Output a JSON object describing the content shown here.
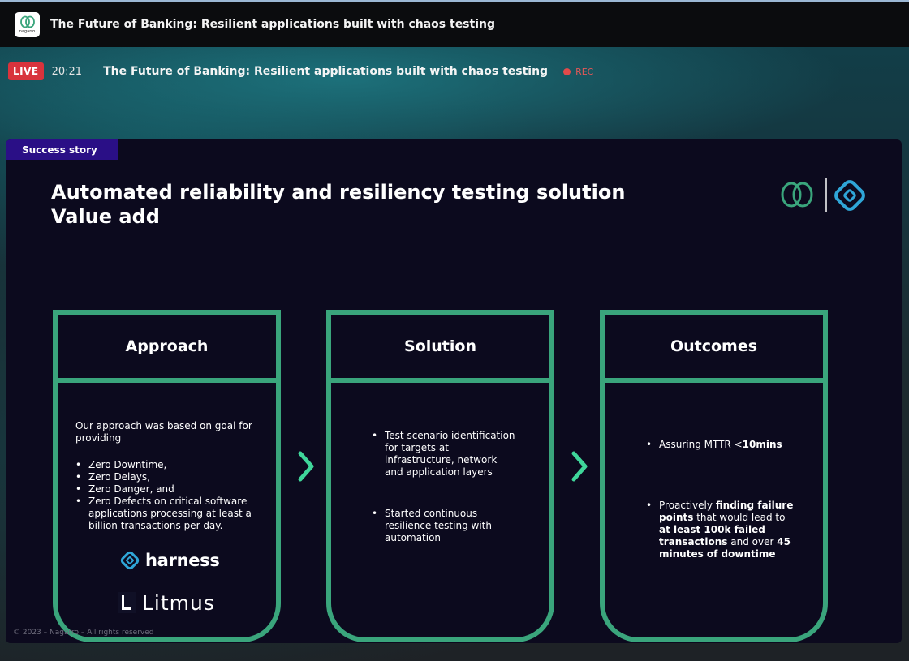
{
  "topbar": {
    "logo_text": "nagarro",
    "title": "The Future of Banking: Resilient applications built with chaos testing"
  },
  "live": {
    "badge": "LIVE",
    "timer": "20:21",
    "title": "The Future of Banking: Resilient applications built with chaos testing",
    "rec_label": "REC"
  },
  "slide": {
    "tag": "Success story",
    "headline_line1": "Automated reliability and resiliency testing solution",
    "headline_line2": "Value add",
    "copyright": "© 2023 – Nagarro – All rights reserved",
    "cards": [
      {
        "title": "Approach",
        "intro": "Our approach was based on goal for providing",
        "bullets": [
          "Zero Downtime,",
          "Zero Delays,",
          "Zero Danger, and",
          "Zero Defects on critical software applications processing at least a billion transactions per day."
        ],
        "logo1": "harness",
        "logo2": "Litmus"
      },
      {
        "title": "Solution",
        "bullets": [
          "Test scenario identification for targets at infrastructure, network and application layers",
          "Started continuous resilience testing with automation"
        ]
      },
      {
        "title": "Outcomes",
        "b1_pre": "Assuring MTTR <",
        "b1_bold": "10mins",
        "b2_pre": "Proactively ",
        "b2_bold1": "finding failure points",
        "b2_mid": " that would lead to ",
        "b2_bold2": "at least 100k failed transactions",
        "b2_mid2": " and over ",
        "b2_bold3": "45 minutes of downtime"
      }
    ]
  },
  "colors": {
    "accent_green": "#3aa57c",
    "tag_purple": "#2a0f86",
    "live_red": "#d8333c",
    "slide_bg": "#0c0a1e"
  }
}
